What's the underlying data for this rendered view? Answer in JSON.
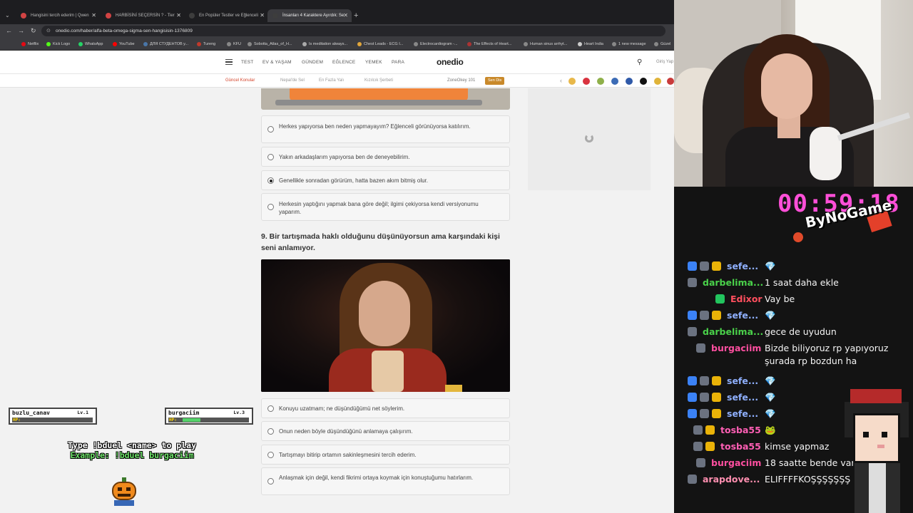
{
  "browser": {
    "tabs": [
      {
        "title": "Hangisini tercih ederim | Qwen",
        "fav": "#d14343",
        "active": false
      },
      {
        "title": "HARBİSİNİ SEÇERSİN ? - Tier",
        "fav": "#d14343",
        "active": false
      },
      {
        "title": "En Popüler Testler ve Eğlenceli",
        "fav": "#3d3d3d",
        "active": false
      },
      {
        "title": "İnsanları 4 Karaktere Ayırdık: Se",
        "fav": "#3d3d3d",
        "active": true
      }
    ],
    "url": "onedio.com/haber/alfa-beta-omega-sigma-sen-hangisisin-1376809",
    "bookmarks": [
      {
        "label": "Netflix",
        "color": "#e50914"
      },
      {
        "label": "Kick Logo",
        "color": "#53fc18"
      },
      {
        "label": "WhatsApp",
        "color": "#25d366"
      },
      {
        "label": "YouTube",
        "color": "#ff0000"
      },
      {
        "label": "ДЛЯ СТУДЕНТОВ у...",
        "color": "#4a76a8"
      },
      {
        "label": "Tureng",
        "color": "#c0392b"
      },
      {
        "label": "KFU",
        "color": "#888888"
      },
      {
        "label": "Sobotta_Atlas_of_H...",
        "color": "#888888"
      },
      {
        "label": "Is meditation always...",
        "color": "#aaaaaa"
      },
      {
        "label": "Chest Leads - ECG I...",
        "color": "#e1a63b"
      },
      {
        "label": "Electrocardiogram -...",
        "color": "#888888"
      },
      {
        "label": "The Effects of Heart...",
        "color": "#aa3333"
      },
      {
        "label": "Human sinus arrhyt...",
        "color": "#888888"
      },
      {
        "label": "Heart India",
        "color": "#cccccc"
      },
      {
        "label": "1 new message",
        "color": "#888888"
      },
      {
        "label": "Güzel",
        "color": "#888888"
      }
    ]
  },
  "site": {
    "nav": [
      "TEST",
      "EV & YAŞAM",
      "GÜNDEM",
      "EĞLENCE",
      "YEMEK",
      "PARA"
    ],
    "logo": "onedio",
    "login": "Giriş Yap",
    "sub": [
      "Güncel Konular",
      "Nepal'de Sel",
      "En Fazla Yalı",
      "Kızılcık Şerbeti",
      "ZoneOkey 101",
      "Sen Dis"
    ]
  },
  "quiz": {
    "q8_options": [
      {
        "text": "Herkes yapıyorsa ben neden yapmayayım? Eğlenceli görünüyorsa katılırım.",
        "selected": false
      },
      {
        "text": "Yakın arkadaşlarım yapıyorsa ben de deneyebilirim.",
        "selected": false
      },
      {
        "text": "Genellikle sonradan görürüm, hatta bazen akım bitmiş olur.",
        "selected": true
      },
      {
        "text": "Herkesin yaptığını yapmak bana göre değil; ilgimi çekiyorsa kendi versiyonumu yaparım.",
        "selected": false
      }
    ],
    "q9_title": "9. Bir tartışmada haklı olduğunu düşünüyorsun ama karşındaki kişi seni anlamıyor.",
    "q9_options": [
      {
        "text": "Konuyu uzatmam; ne düşündüğümü net söylerim.",
        "selected": false
      },
      {
        "text": "Onun neden böyle düşündüğünü anlamaya çalışırım.",
        "selected": false
      },
      {
        "text": "Tartışmayı bitirip ortamın sakinleşmesini tercih ederim.",
        "selected": false
      },
      {
        "text": "Anlaşmak için değil, kendi fikrimi ortaya koymak için konuştuğumu hatırlarım.",
        "selected": false
      }
    ]
  },
  "overlay": {
    "player1": {
      "name": "buzlu_canav",
      "level": "Lv.1",
      "hp": "HP:",
      "hp_fraction": 0
    },
    "player2": {
      "name": "burgaciim",
      "level": "Lv.3",
      "hp": "HP:",
      "hp_fraction": 0.25
    },
    "bduel_line1": "Type !bduel <name> to play",
    "bduel_line2": "Example: !bduel burgaciim",
    "timer": "00:59:18",
    "stream_logo": "ByNoGame"
  },
  "chat": [
    {
      "name": "sefe...",
      "color": "#8fb0ff",
      "msg": "💎",
      "badges": [
        "#3b82f6",
        "#6b7280",
        "#eab308"
      ]
    },
    {
      "name": "darbelima...",
      "color": "#4ad14a",
      "msg": "1 saat daha ekle",
      "badges": [
        "#6b7280"
      ]
    },
    {
      "name": "Edixor",
      "color": "#ff4f5e",
      "msg": "Vay be",
      "badges": [
        "#22c55e"
      ]
    },
    {
      "name": "sefe...",
      "color": "#8fb0ff",
      "msg": "💎",
      "badges": [
        "#3b82f6",
        "#6b7280",
        "#eab308"
      ]
    },
    {
      "name": "darbelima...",
      "color": "#4ad14a",
      "msg": "gece de uyudun",
      "badges": [
        "#6b7280"
      ]
    },
    {
      "name": "burgaciim",
      "color": "#ff4fa0",
      "msg": "Bizde biliyoruz rp yapıyoruz",
      "msg2": "şurada rp bozdun ha",
      "badges": [
        "#6b7280"
      ]
    },
    {
      "name": "sefe...",
      "color": "#8fb0ff",
      "msg": "💎",
      "badges": [
        "#3b82f6",
        "#6b7280",
        "#eab308"
      ]
    },
    {
      "name": "sefe...",
      "color": "#8fb0ff",
      "msg": "💎",
      "badges": [
        "#3b82f6",
        "#6b7280",
        "#eab308"
      ]
    },
    {
      "name": "sefe...",
      "color": "#8fb0ff",
      "msg": "💎",
      "badges": [
        "#3b82f6",
        "#6b7280",
        "#eab308"
      ]
    },
    {
      "name": "tosba55",
      "color": "#ff5fb5",
      "msg": "🐸",
      "badges": [
        "#6b7280",
        "#eab308"
      ]
    },
    {
      "name": "tosba55",
      "color": "#ff5fb5",
      "msg": "kimse yapmaz",
      "badges": [
        "#6b7280",
        "#eab308"
      ]
    },
    {
      "name": "burgaciim",
      "color": "#ff4fa0",
      "msg": "18 saatte bende var",
      "badges": [
        "#6b7280"
      ]
    },
    {
      "name": "arapdove...",
      "color": "#ff8fb0",
      "msg": "ELIFFFFKOŞŞŞŞŞŞŞ",
      "badges": [
        "#6b7280"
      ]
    }
  ]
}
